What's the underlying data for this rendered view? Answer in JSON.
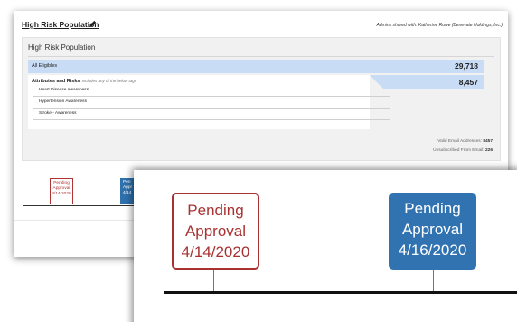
{
  "header": {
    "title": "High Risk Population",
    "admins_note": "Admins shared with: Katherine Rowe (Benevate Holdings, Inc.)"
  },
  "panel": {
    "title": "High Risk Population",
    "all_eligibles": {
      "label": "All Eligibles",
      "value": "29,718"
    },
    "attributes": {
      "label": "Attributes and Risks",
      "hint": "Includes any of the below tags",
      "value": "8,457",
      "tags": [
        "Heart Disease Awareness",
        "Hypertension Awareness",
        "Stroke - Awareness"
      ]
    },
    "valid_email_label": "Valid Email Addresses:",
    "valid_email_value": "8457",
    "unsubscribed_label": "Unsubscribed From Email:",
    "unsubscribed_value": "226"
  },
  "timeline_back": {
    "red_box": {
      "line1": "Pending",
      "line2": "Approval",
      "line3": "4/14/2020"
    },
    "blue_box": {
      "line1": "Pen",
      "line2": "Appr",
      "line3": "4/14"
    }
  },
  "timeline_zoom": {
    "red_box": {
      "line1": "Pending",
      "line2": "Approval",
      "line3": "4/14/2020"
    },
    "blue_box": {
      "line1": "Pending",
      "line2": "Approval",
      "line3": "4/16/2020"
    }
  },
  "icons": {
    "edit": "pencil-icon"
  },
  "colors": {
    "pending_red": "#a83232",
    "pending_blue": "#3173b1",
    "highlight_blue": "#c8dcf5"
  }
}
